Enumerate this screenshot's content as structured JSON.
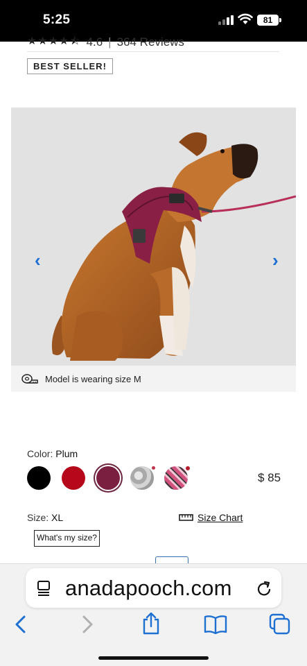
{
  "status_bar": {
    "time": "5:25",
    "battery": "81"
  },
  "product": {
    "rating_value": "4.6",
    "rating_separator": "|",
    "reviews": "364 Reviews",
    "badge": "BEST SELLER!",
    "model_note": "Model is wearing size M",
    "color_label": "Color:",
    "color_value": "Plum",
    "price": "$ 85",
    "size_label": "Size:",
    "size_value": "XL",
    "size_chart": "Size Chart",
    "whats_my_size": "What's my size?"
  },
  "swatches": [
    {
      "name": "black",
      "color": "#000000",
      "selected": false
    },
    {
      "name": "red",
      "color": "#b5081b",
      "selected": false
    },
    {
      "name": "plum",
      "color": "#7a1f3f",
      "selected": true
    },
    {
      "name": "grey-pattern",
      "color": "#b8b8b8",
      "selected": false
    },
    {
      "name": "pink-plaid",
      "color": "#d2527f",
      "selected": false
    }
  ],
  "browser": {
    "url": "anadapooch.com"
  },
  "colors": {
    "link_blue": "#1d6fd1",
    "plum": "#7a1f3f"
  }
}
